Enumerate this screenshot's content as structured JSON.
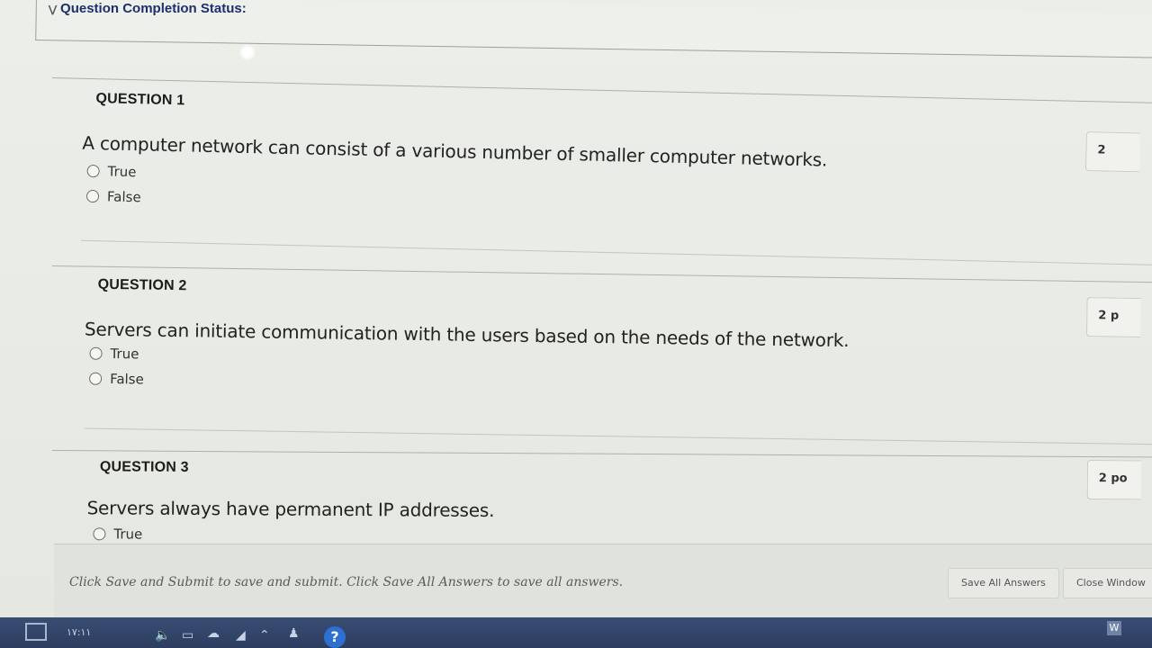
{
  "status": {
    "title": "Question Completion Status:"
  },
  "questions": [
    {
      "heading": "QUESTION 1",
      "text": "A computer network can consist of a various number of smaller computer networks.",
      "points": "2",
      "options": [
        "True",
        "False"
      ]
    },
    {
      "heading": "QUESTION 2",
      "text": "Servers can initiate communication with the users based on the needs of the network.",
      "points": "2 p",
      "options": [
        "True",
        "False"
      ]
    },
    {
      "heading": "QUESTION 3",
      "text": "Servers always have permanent IP addresses.",
      "points": "2 po",
      "options": [
        "True"
      ]
    }
  ],
  "footer": {
    "note": "Click Save and Submit to save and submit. Click Save All Answers to save all answers.",
    "save_all_label": "Save All Answers",
    "close_window_label": "Close Window"
  },
  "taskbar": {
    "clock": "۱۷:۱۱"
  }
}
